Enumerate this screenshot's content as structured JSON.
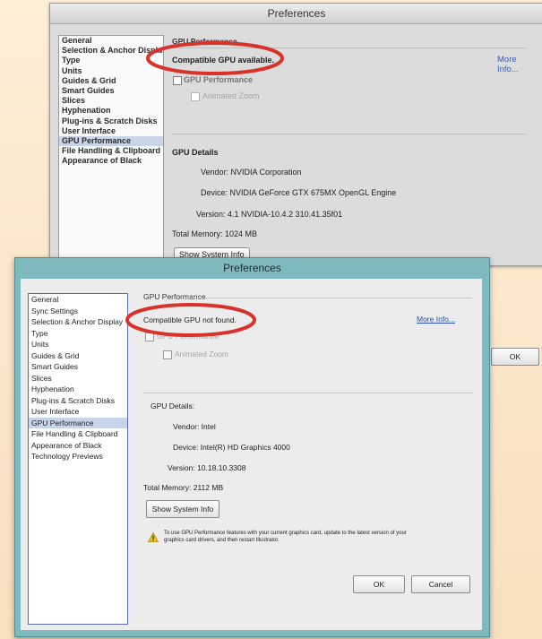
{
  "back_window": {
    "title": "Preferences",
    "categories": [
      {
        "label": "General",
        "selected": false
      },
      {
        "label": "Selection & Anchor Display",
        "selected": false
      },
      {
        "label": "Type",
        "selected": false
      },
      {
        "label": "Units",
        "selected": false
      },
      {
        "label": "Guides & Grid",
        "selected": false
      },
      {
        "label": "Smart Guides",
        "selected": false
      },
      {
        "label": "Slices",
        "selected": false
      },
      {
        "label": "Hyphenation",
        "selected": false
      },
      {
        "label": "Plug-ins & Scratch Disks",
        "selected": false
      },
      {
        "label": "User Interface",
        "selected": false
      },
      {
        "label": "GPU Performance",
        "selected": true
      },
      {
        "label": "File Handling & Clipboard",
        "selected": false
      },
      {
        "label": "Appearance of Black",
        "selected": false
      }
    ],
    "group_title": "GPU Performance",
    "status": "Compatible GPU available.",
    "more_info": "More Info...",
    "gpu_checkbox_label": "GPU Performance",
    "animated_zoom_label": "Animated Zoom",
    "details_title": "GPU Details",
    "vendor": "Vendor: NVIDIA Corporation",
    "device": "Device: NVIDIA GeForce GTX 675MX OpenGL Engine",
    "version": "Version: 4.1 NVIDIA-10.4.2 310.41.35f01",
    "total_memory": "Total Memory: 1024 MB",
    "show_system_info": "Show System Info"
  },
  "front_window": {
    "title": "Preferences",
    "categories": [
      {
        "label": "General",
        "selected": false
      },
      {
        "label": "Sync Settings",
        "selected": false
      },
      {
        "label": "Selection & Anchor Display",
        "selected": false
      },
      {
        "label": "Type",
        "selected": false
      },
      {
        "label": "Units",
        "selected": false
      },
      {
        "label": "Guides & Grid",
        "selected": false
      },
      {
        "label": "Smart Guides",
        "selected": false
      },
      {
        "label": "Slices",
        "selected": false
      },
      {
        "label": "Hyphenation",
        "selected": false
      },
      {
        "label": "Plug-ins & Scratch Disks",
        "selected": false
      },
      {
        "label": "User Interface",
        "selected": false
      },
      {
        "label": "GPU Performance",
        "selected": true
      },
      {
        "label": "File Handling & Clipboard",
        "selected": false
      },
      {
        "label": "Appearance of Black",
        "selected": false
      },
      {
        "label": "Technology Previews",
        "selected": false
      }
    ],
    "group_title": "GPU Performance",
    "status": "Compatible GPU not found.",
    "more_info": "More Info...",
    "gpu_checkbox_label": "GPU Performance",
    "animated_zoom_label": "Animated Zoom",
    "details_title": "GPU Details:",
    "vendor": "Vendor: Intel",
    "device": "Device: Intel(R) HD Graphics 4000",
    "version": "Version: 10.18.10.3308",
    "total_memory": "Total Memory: 2112 MB",
    "show_system_info": "Show System Info",
    "warning_icon": "warning-icon",
    "warning_line1": "To use GPU Performance features with your current graphics card, update to the latest version of your",
    "warning_line2": "graphics card drivers, and then restart Illustrator.",
    "ok": "OK",
    "cancel": "Cancel"
  },
  "back_ok": "OK",
  "colors": {
    "highlight": "#d8322b",
    "background": "#fbe7c9",
    "win_frame": "#7fb8bd",
    "selection": "#c7d4ea"
  }
}
